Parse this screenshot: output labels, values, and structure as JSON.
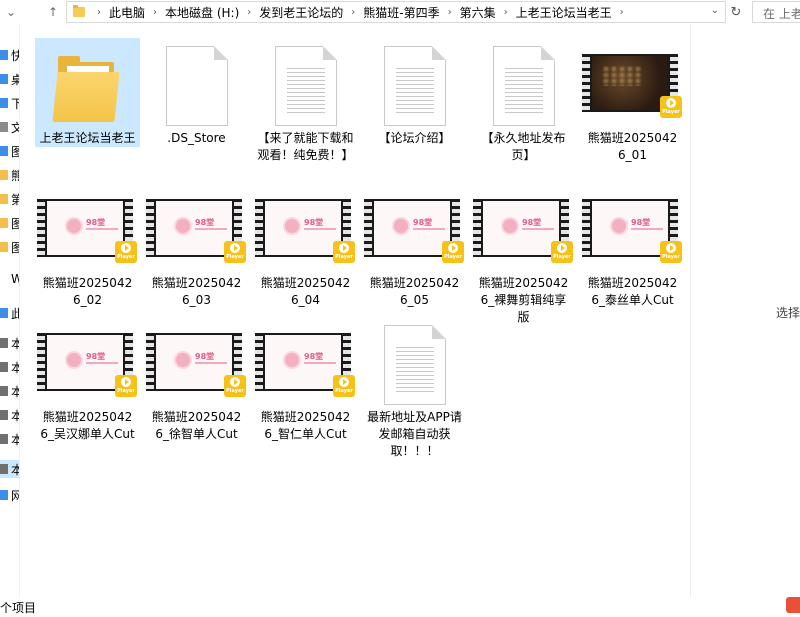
{
  "nav": {
    "back_icon": "arrow-left-icon",
    "forward_icon": "arrow-right-icon",
    "recent_icon": "chevron-down-icon",
    "up_icon": "arrow-up-icon",
    "refresh_icon": "refresh-icon"
  },
  "address": {
    "crumbs": [
      "此电脑",
      "本地磁盘 (H:)",
      "发到老王论坛的",
      "熊猫班-第四季",
      "第六集",
      "上老王论坛当老王"
    ]
  },
  "search": {
    "placeholder": "在 上老"
  },
  "sidebar": {
    "items": [
      {
        "label": "快",
        "icon": "star-icon"
      },
      {
        "label": "桌",
        "icon": "desktop-icon"
      },
      {
        "label": "下",
        "icon": "download-icon"
      },
      {
        "label": "文",
        "icon": "document-icon"
      },
      {
        "label": "图",
        "icon": "picture-icon"
      },
      {
        "label": "熊",
        "icon": "folder-icon"
      },
      {
        "label": "第",
        "icon": "folder-icon"
      },
      {
        "label": "图",
        "icon": "folder-icon"
      },
      {
        "label": "图",
        "icon": "folder-icon"
      },
      {
        "label": "W",
        "icon": "cloud-icon"
      },
      {
        "label": "此",
        "icon": "computer-icon"
      },
      {
        "label": "本",
        "icon": "drive-icon"
      },
      {
        "label": "本",
        "icon": "drive-icon"
      },
      {
        "label": "本",
        "icon": "drive-icon"
      },
      {
        "label": "本",
        "icon": "drive-icon"
      },
      {
        "label": "本",
        "icon": "drive-icon"
      },
      {
        "label": "本",
        "icon": "drive-icon"
      },
      {
        "label": "网",
        "icon": "network-icon"
      }
    ]
  },
  "files": [
    {
      "name": "上老王论坛当老王",
      "type": "folder"
    },
    {
      "name": ".DS_Store",
      "type": "file"
    },
    {
      "name": "【来了就能下载和观看！纯免费！】",
      "type": "document"
    },
    {
      "name": "【论坛介绍】",
      "type": "document"
    },
    {
      "name": "【永久地址发布页】",
      "type": "document"
    },
    {
      "name": "熊猫班20250426_01",
      "type": "video",
      "thumb": "dark"
    },
    {
      "name": "熊猫班20250426_02",
      "type": "video"
    },
    {
      "name": "熊猫班20250426_03",
      "type": "video"
    },
    {
      "name": "熊猫班20250426_04",
      "type": "video"
    },
    {
      "name": "熊猫班20250426_05",
      "type": "video"
    },
    {
      "name": "熊猫班20250426_裸舞剪辑纯享版",
      "type": "video"
    },
    {
      "name": "熊猫班20250426_泰丝单人Cut",
      "type": "video"
    },
    {
      "name": "熊猫班20250426_吴汉娜单人Cut",
      "type": "video"
    },
    {
      "name": "熊猫班20250426_徐智单人Cut",
      "type": "video"
    },
    {
      "name": "熊猫班20250426_智仁单人Cut",
      "type": "video"
    },
    {
      "name": "最新地址及APP请发邮箱自动获取！！！",
      "type": "document"
    }
  ],
  "thumbnail": {
    "brand_text": "98堂",
    "badge_text": "Player"
  },
  "details": {
    "message": "选择"
  },
  "status": {
    "count": "个项目"
  },
  "colors": {
    "selection": "#cce8ff",
    "folder": "#f4c449",
    "badge": "#f6c21a"
  }
}
